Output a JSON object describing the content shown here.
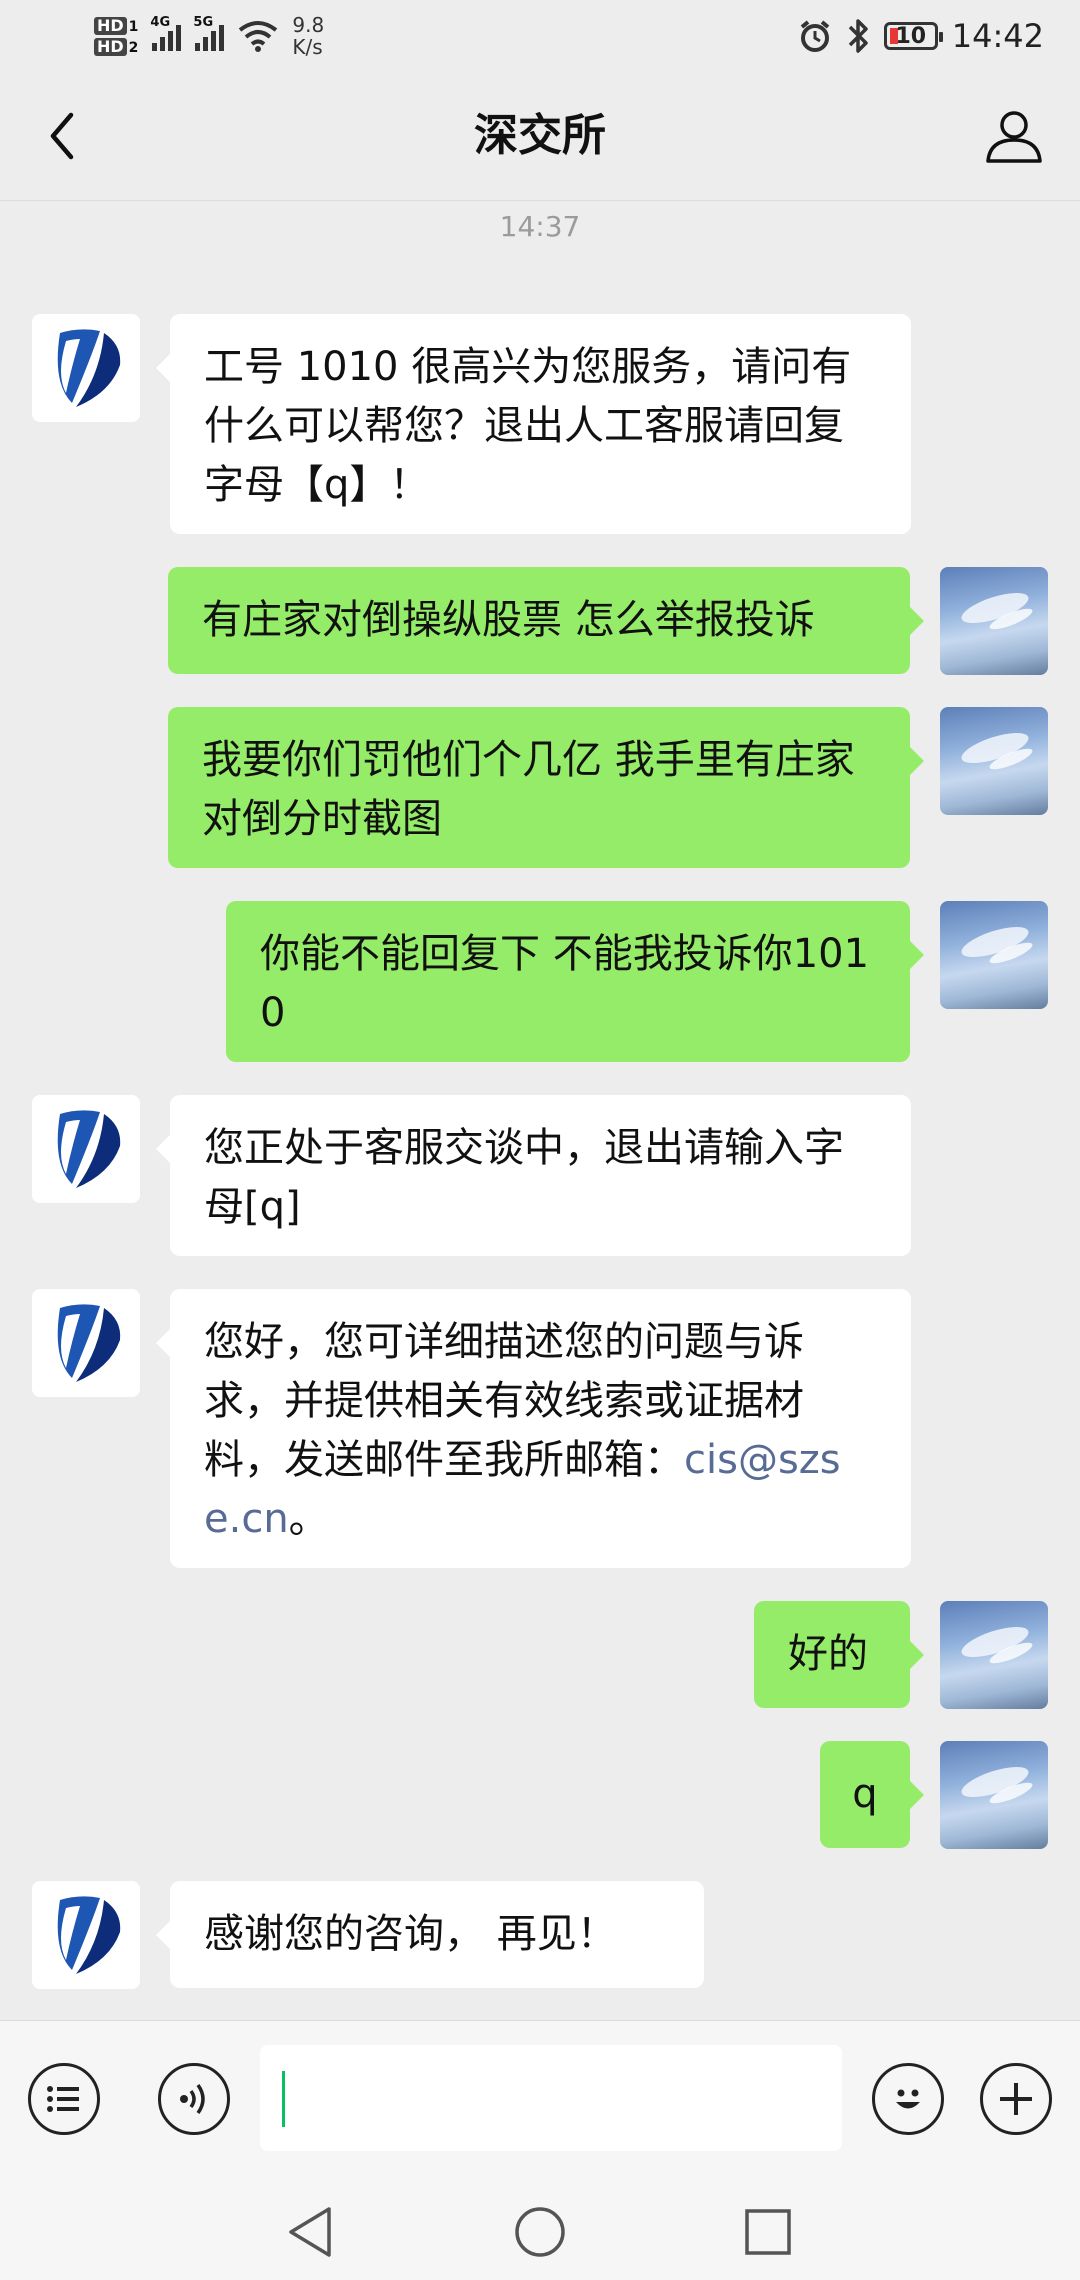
{
  "status_bar": {
    "hd1": "HD",
    "hd1_sub": "1",
    "hd2": "HD",
    "hd2_sub": "2",
    "sig1_tag": "4G",
    "sig2_tag": "5G",
    "speed_value": "9.8",
    "speed_unit": "K/s",
    "battery_level": "10",
    "time": "14:42",
    "icons": [
      "alarm-icon",
      "bluetooth-icon",
      "battery-icon",
      "wifi-icon",
      "signal-icon"
    ]
  },
  "header": {
    "title": "深交所",
    "back_icon": "chevron-left-icon",
    "profile_icon": "person-icon"
  },
  "chat": {
    "timestamp": "14:37",
    "messages": [
      {
        "from": "bot",
        "text": "工号 1010 很高兴为您服务，请问有什么可以帮您？退出人工客服请回复字母【q】！"
      },
      {
        "from": "me",
        "text": "有庄家对倒操纵股票 怎么举报投诉"
      },
      {
        "from": "me",
        "text": "我要你们罚他们个几亿 我手里有庄家对倒分时截图"
      },
      {
        "from": "me",
        "text": "你能不能回复下 不能我投诉你1010"
      },
      {
        "from": "bot",
        "text": "您正处于客服交谈中，退出请输入字母[q]"
      },
      {
        "from": "bot",
        "text_before": "您好，您可详细描述您的问题与诉求，并提供相关有效线索或证据材料，发送邮件至我所邮箱：",
        "link": "cis@szse.cn",
        "text_after": "。"
      },
      {
        "from": "me",
        "text": "好的"
      },
      {
        "from": "me",
        "text": "q"
      },
      {
        "from": "bot",
        "text": "感谢您的咨询， 再见！"
      }
    ]
  },
  "input_bar": {
    "value": "",
    "placeholder": "",
    "icons": [
      "menu-list-icon",
      "voice-icon",
      "emoji-icon",
      "add-icon"
    ]
  },
  "nav_bar": {
    "icons": [
      "nav-back-icon",
      "nav-home-icon",
      "nav-recents-icon"
    ]
  },
  "colors": {
    "background": "#ededed",
    "sent_bubble": "#95ec69",
    "received_bubble": "#ffffff",
    "link": "#576b95",
    "caret": "#07c160"
  }
}
